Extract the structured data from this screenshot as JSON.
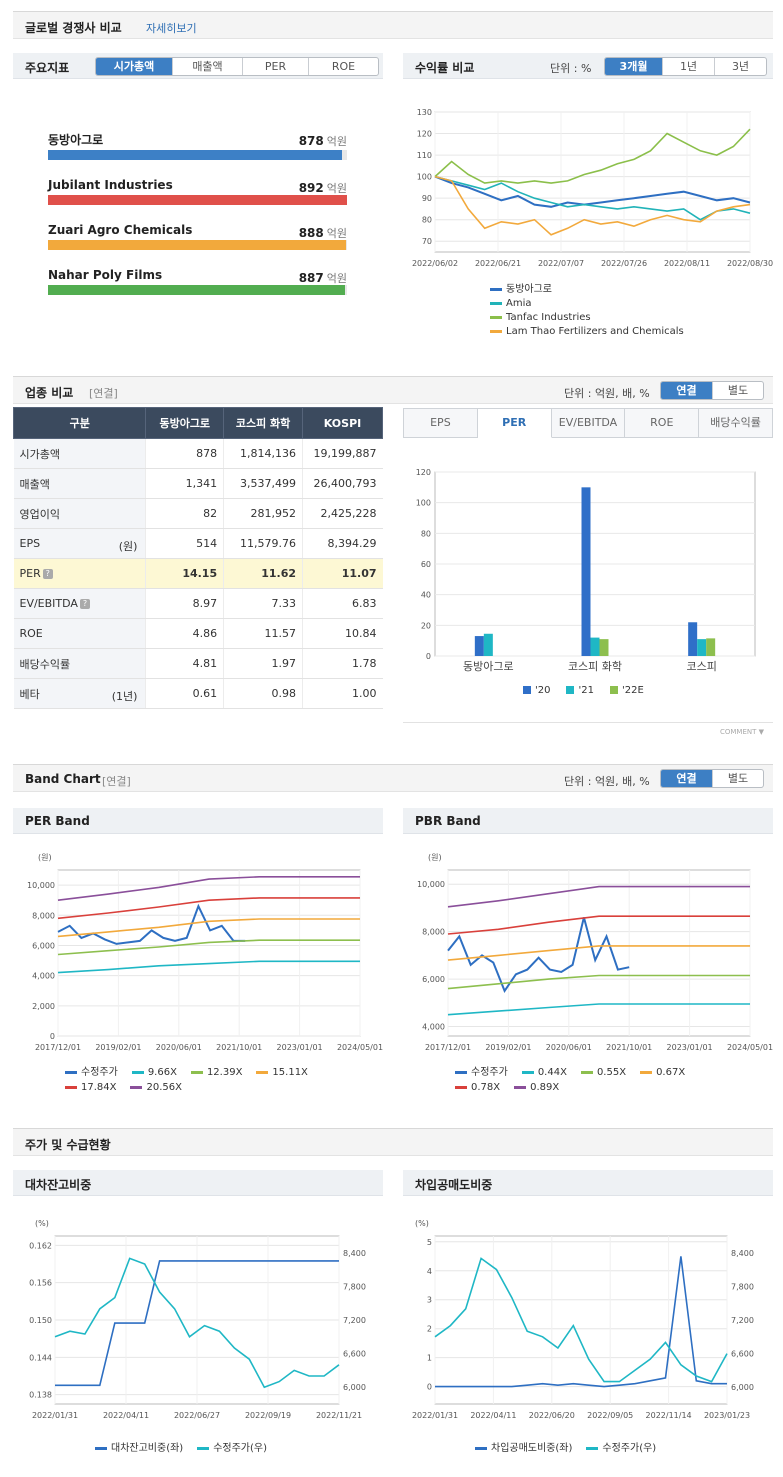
{
  "global": {
    "title": "글로벌 경쟁사 비교",
    "more_link": "자세히보기"
  },
  "indicators": {
    "title": "주요지표",
    "tabs": [
      "시가총액",
      "매출액",
      "PER",
      "ROE"
    ],
    "active_tab": 0,
    "unit": "억원",
    "items": [
      {
        "name": "동방아그로",
        "value": "878",
        "color": "#3d80c6",
        "fill": 0.984
      },
      {
        "name": "Jubilant Industries",
        "value": "892",
        "color": "#e0504a",
        "fill": 1.0
      },
      {
        "name": "Zuari Agro Chemicals",
        "value": "888",
        "color": "#f2a93c",
        "fill": 0.996
      },
      {
        "name": "Nahar Poly Films",
        "value": "887",
        "color": "#52ad50",
        "fill": 0.994
      }
    ]
  },
  "returns": {
    "title": "수익률 비교",
    "unit_label": "단위 : %",
    "periods": [
      "3개월",
      "1년",
      "3년"
    ],
    "active_period": 0
  },
  "industry": {
    "title": "업종 비교",
    "tag": "[연결]",
    "unit_label": "단위 : 억원, 배, %",
    "toggle": [
      "연결",
      "별도"
    ],
    "columns": [
      "구분",
      "동방아그로",
      "코스피 화학",
      "KOSPI"
    ],
    "rows": [
      {
        "label": "시가총액",
        "sub": "",
        "values": [
          "878",
          "1,814,136",
          "19,199,887"
        ],
        "hl": false,
        "help": false
      },
      {
        "label": "매출액",
        "sub": "",
        "values": [
          "1,341",
          "3,537,499",
          "26,400,793"
        ],
        "hl": false,
        "help": false
      },
      {
        "label": "영업이익",
        "sub": "",
        "values": [
          "82",
          "281,952",
          "2,425,228"
        ],
        "hl": false,
        "help": false
      },
      {
        "label": "EPS",
        "sub": "(원)",
        "values": [
          "514",
          "11,579.76",
          "8,394.29"
        ],
        "hl": false,
        "help": false
      },
      {
        "label": "PER",
        "sub": "",
        "values": [
          "14.15",
          "11.62",
          "11.07"
        ],
        "hl": true,
        "help": true
      },
      {
        "label": "EV/EBITDA",
        "sub": "",
        "values": [
          "8.97",
          "7.33",
          "6.83"
        ],
        "hl": false,
        "help": true
      },
      {
        "label": "ROE",
        "sub": "",
        "values": [
          "4.86",
          "11.57",
          "10.84"
        ],
        "hl": false,
        "help": false
      },
      {
        "label": "배당수익률",
        "sub": "",
        "values": [
          "4.81",
          "1.97",
          "1.78"
        ],
        "hl": false,
        "help": false
      },
      {
        "label": "베타",
        "sub": "(1년)",
        "values": [
          "0.61",
          "0.98",
          "1.00"
        ],
        "hl": false,
        "help": false
      }
    ],
    "chart_tabs": [
      "EPS",
      "PER",
      "EV/EBITDA",
      "ROE",
      "배당수익률"
    ],
    "active_chart_tab": 1,
    "comment": "COMMENT"
  },
  "band": {
    "title": "Band Chart",
    "tag": "[연결]",
    "unit_label": "단위 : 억원, 배, %",
    "toggle": [
      "연결",
      "별도"
    ],
    "per_title": "PER Band",
    "pbr_title": "PBR Band"
  },
  "supply": {
    "title": "주가 및 수급현황",
    "loan_title": "대차잔고비중",
    "short_title": "차입공매도비중"
  },
  "chart_data": [
    {
      "type": "line",
      "id": "returns",
      "x": [
        "2022/06/02",
        "2022/06/21",
        "2022/07/07",
        "2022/07/26",
        "2022/08/11",
        "2022/08/30"
      ],
      "ylim": [
        65,
        130
      ],
      "yticks": [
        70,
        80,
        90,
        100,
        110,
        120,
        130
      ],
      "series": [
        {
          "name": "동방아그로",
          "color": "#2e6fc2",
          "values": [
            100,
            97,
            95,
            92,
            89,
            91,
            87,
            86,
            88,
            87,
            88,
            89,
            90,
            91,
            92,
            93,
            91,
            89,
            90,
            88
          ]
        },
        {
          "name": "Amia",
          "color": "#21b3b8",
          "values": [
            100,
            98,
            96,
            94,
            97,
            93,
            90,
            88,
            86,
            87,
            86,
            85,
            86,
            85,
            84,
            85,
            80,
            84,
            85,
            83
          ]
        },
        {
          "name": "Tanfac Industries",
          "color": "#8bbf4a",
          "values": [
            100,
            107,
            101,
            97,
            98,
            97,
            98,
            97,
            98,
            101,
            103,
            106,
            108,
            112,
            120,
            116,
            112,
            110,
            114,
            122
          ]
        },
        {
          "name": "Lam Thao Fertilizers and Chemicals",
          "color": "#f2a93c",
          "values": [
            100,
            98,
            85,
            76,
            79,
            78,
            80,
            73,
            76,
            80,
            78,
            79,
            77,
            80,
            82,
            80,
            79,
            84,
            86,
            87
          ]
        }
      ]
    },
    {
      "type": "bar",
      "id": "per-compare",
      "categories": [
        "동방아그로",
        "코스피 화학",
        "코스피"
      ],
      "ylim": [
        0,
        120
      ],
      "yticks": [
        0,
        20,
        40,
        60,
        80,
        100,
        120
      ],
      "series": [
        {
          "name": "'20",
          "color": "#2f6fc8",
          "values": [
            13,
            110,
            22
          ]
        },
        {
          "name": "'21",
          "color": "#1fb7c5",
          "values": [
            14.5,
            12,
            11
          ]
        },
        {
          "name": "'22E",
          "color": "#8dbf4e",
          "values": [
            0,
            11,
            11.5
          ]
        }
      ]
    },
    {
      "type": "line",
      "id": "per-band",
      "ylabel": "(원)",
      "x": [
        "2017/12/01",
        "2019/02/01",
        "2020/06/01",
        "2021/10/01",
        "2023/01/01",
        "2024/05/01"
      ],
      "ylim": [
        0,
        11000
      ],
      "yticks": [
        0,
        2000,
        4000,
        6000,
        8000,
        10000
      ],
      "series": [
        {
          "name": "수정주가",
          "color": "#2e6fc2",
          "values": [
            6900,
            7300,
            6500,
            6800,
            6400,
            6100,
            6200,
            6300,
            7000,
            6500,
            6300,
            6500,
            8600,
            7000,
            7300,
            6300,
            6300
          ]
        },
        {
          "name": "9.66X",
          "color": "#1fb7c5",
          "values": [
            4200,
            4400,
            4650,
            4800,
            4950,
            4950,
            4950
          ]
        },
        {
          "name": "12.39X",
          "color": "#8dbf4e",
          "values": [
            5400,
            5650,
            5900,
            6200,
            6350,
            6350,
            6350
          ]
        },
        {
          "name": "15.11X",
          "color": "#f2a93c",
          "values": [
            6600,
            6900,
            7200,
            7600,
            7750,
            7750,
            7750
          ]
        },
        {
          "name": "17.84X",
          "color": "#d9403b",
          "values": [
            7800,
            8150,
            8550,
            9000,
            9150,
            9150,
            9150
          ]
        },
        {
          "name": "20.56X",
          "color": "#8a4f9a",
          "values": [
            9000,
            9400,
            9850,
            10400,
            10550,
            10550,
            10550
          ]
        }
      ]
    },
    {
      "type": "line",
      "id": "pbr-band",
      "ylabel": "(원)",
      "x": [
        "2017/12/01",
        "2019/02/01",
        "2020/06/01",
        "2021/10/01",
        "2023/01/01",
        "2024/05/01"
      ],
      "ylim": [
        3600,
        10600
      ],
      "yticks": [
        4000,
        6000,
        8000,
        10000
      ],
      "series": [
        {
          "name": "수정주가",
          "color": "#2e6fc2",
          "values": [
            7200,
            7800,
            6600,
            7000,
            6700,
            5500,
            6200,
            6400,
            6900,
            6400,
            6300,
            6600,
            8600,
            6800,
            7800,
            6400,
            6500
          ]
        },
        {
          "name": "0.44X",
          "color": "#1fb7c5",
          "values": [
            4500,
            4650,
            4800,
            4950,
            4950,
            4950,
            4950
          ]
        },
        {
          "name": "0.55X",
          "color": "#8dbf4e",
          "values": [
            5600,
            5800,
            6000,
            6150,
            6150,
            6150,
            6150
          ]
        },
        {
          "name": "0.67X",
          "color": "#f2a93c",
          "values": [
            6800,
            7000,
            7200,
            7400,
            7400,
            7400,
            7400
          ]
        },
        {
          "name": "0.78X",
          "color": "#d9403b",
          "values": [
            7900,
            8100,
            8400,
            8650,
            8650,
            8650,
            8650
          ]
        },
        {
          "name": "0.89X",
          "color": "#8a4f9a",
          "values": [
            9050,
            9300,
            9600,
            9900,
            9900,
            9900,
            9900
          ]
        }
      ]
    },
    {
      "type": "line",
      "id": "loan-balance",
      "ylabel": "(%)",
      "x": [
        "2022/01/31",
        "2022/04/11",
        "2022/06/27",
        "2022/09/19",
        "2022/11/21"
      ],
      "ylim": [
        0.1365,
        0.1635
      ],
      "yticks": [
        0.138,
        0.144,
        0.15,
        0.156,
        0.162
      ],
      "y2lim": [
        5700,
        8700
      ],
      "y2ticks": [
        6000,
        6600,
        7200,
        7800,
        8400
      ],
      "series": [
        {
          "name": "대차잔고비중(좌)",
          "color": "#2e6fc2",
          "axis": "left",
          "values": [
            0.1395,
            0.1395,
            0.1395,
            0.1395,
            0.1495,
            0.1495,
            0.1495,
            0.1595,
            0.1595,
            0.1595,
            0.1595,
            0.1595,
            0.1595,
            0.1595,
            0.1595,
            0.1595,
            0.1595,
            0.1595,
            0.1595,
            0.1595
          ]
        },
        {
          "name": "수정주가(우)",
          "color": "#1fb7c5",
          "axis": "right",
          "values": [
            6900,
            7000,
            6950,
            7400,
            7600,
            8300,
            8200,
            7700,
            7400,
            6900,
            7100,
            7000,
            6700,
            6500,
            6000,
            6100,
            6300,
            6200,
            6200,
            6400
          ]
        }
      ]
    },
    {
      "type": "line",
      "id": "short-selling",
      "ylabel": "(%)",
      "x": [
        "2022/01/31",
        "2022/04/11",
        "2022/06/20",
        "2022/09/05",
        "2022/11/14",
        "2023/01/23"
      ],
      "ylim": [
        -0.6,
        5.2
      ],
      "yticks": [
        0,
        1,
        2,
        3,
        4,
        5
      ],
      "y2lim": [
        5700,
        8700
      ],
      "y2ticks": [
        6000,
        6600,
        7200,
        7800,
        8400
      ],
      "series": [
        {
          "name": "차입공매도비중(좌)",
          "color": "#2e6fc2",
          "axis": "left",
          "values": [
            0,
            0,
            0,
            0,
            0,
            0,
            0.05,
            0.1,
            0.05,
            0.1,
            0.05,
            0,
            0.05,
            0.1,
            0.2,
            0.3,
            4.5,
            0.2,
            0.1,
            0.1
          ]
        },
        {
          "name": "수정주가(우)",
          "color": "#1fb7c5",
          "axis": "right",
          "values": [
            6900,
            7100,
            7400,
            8300,
            8100,
            7600,
            7000,
            6900,
            6700,
            7100,
            6500,
            6100,
            6100,
            6300,
            6500,
            6800,
            6400,
            6200,
            6100,
            6600
          ]
        }
      ]
    }
  ]
}
